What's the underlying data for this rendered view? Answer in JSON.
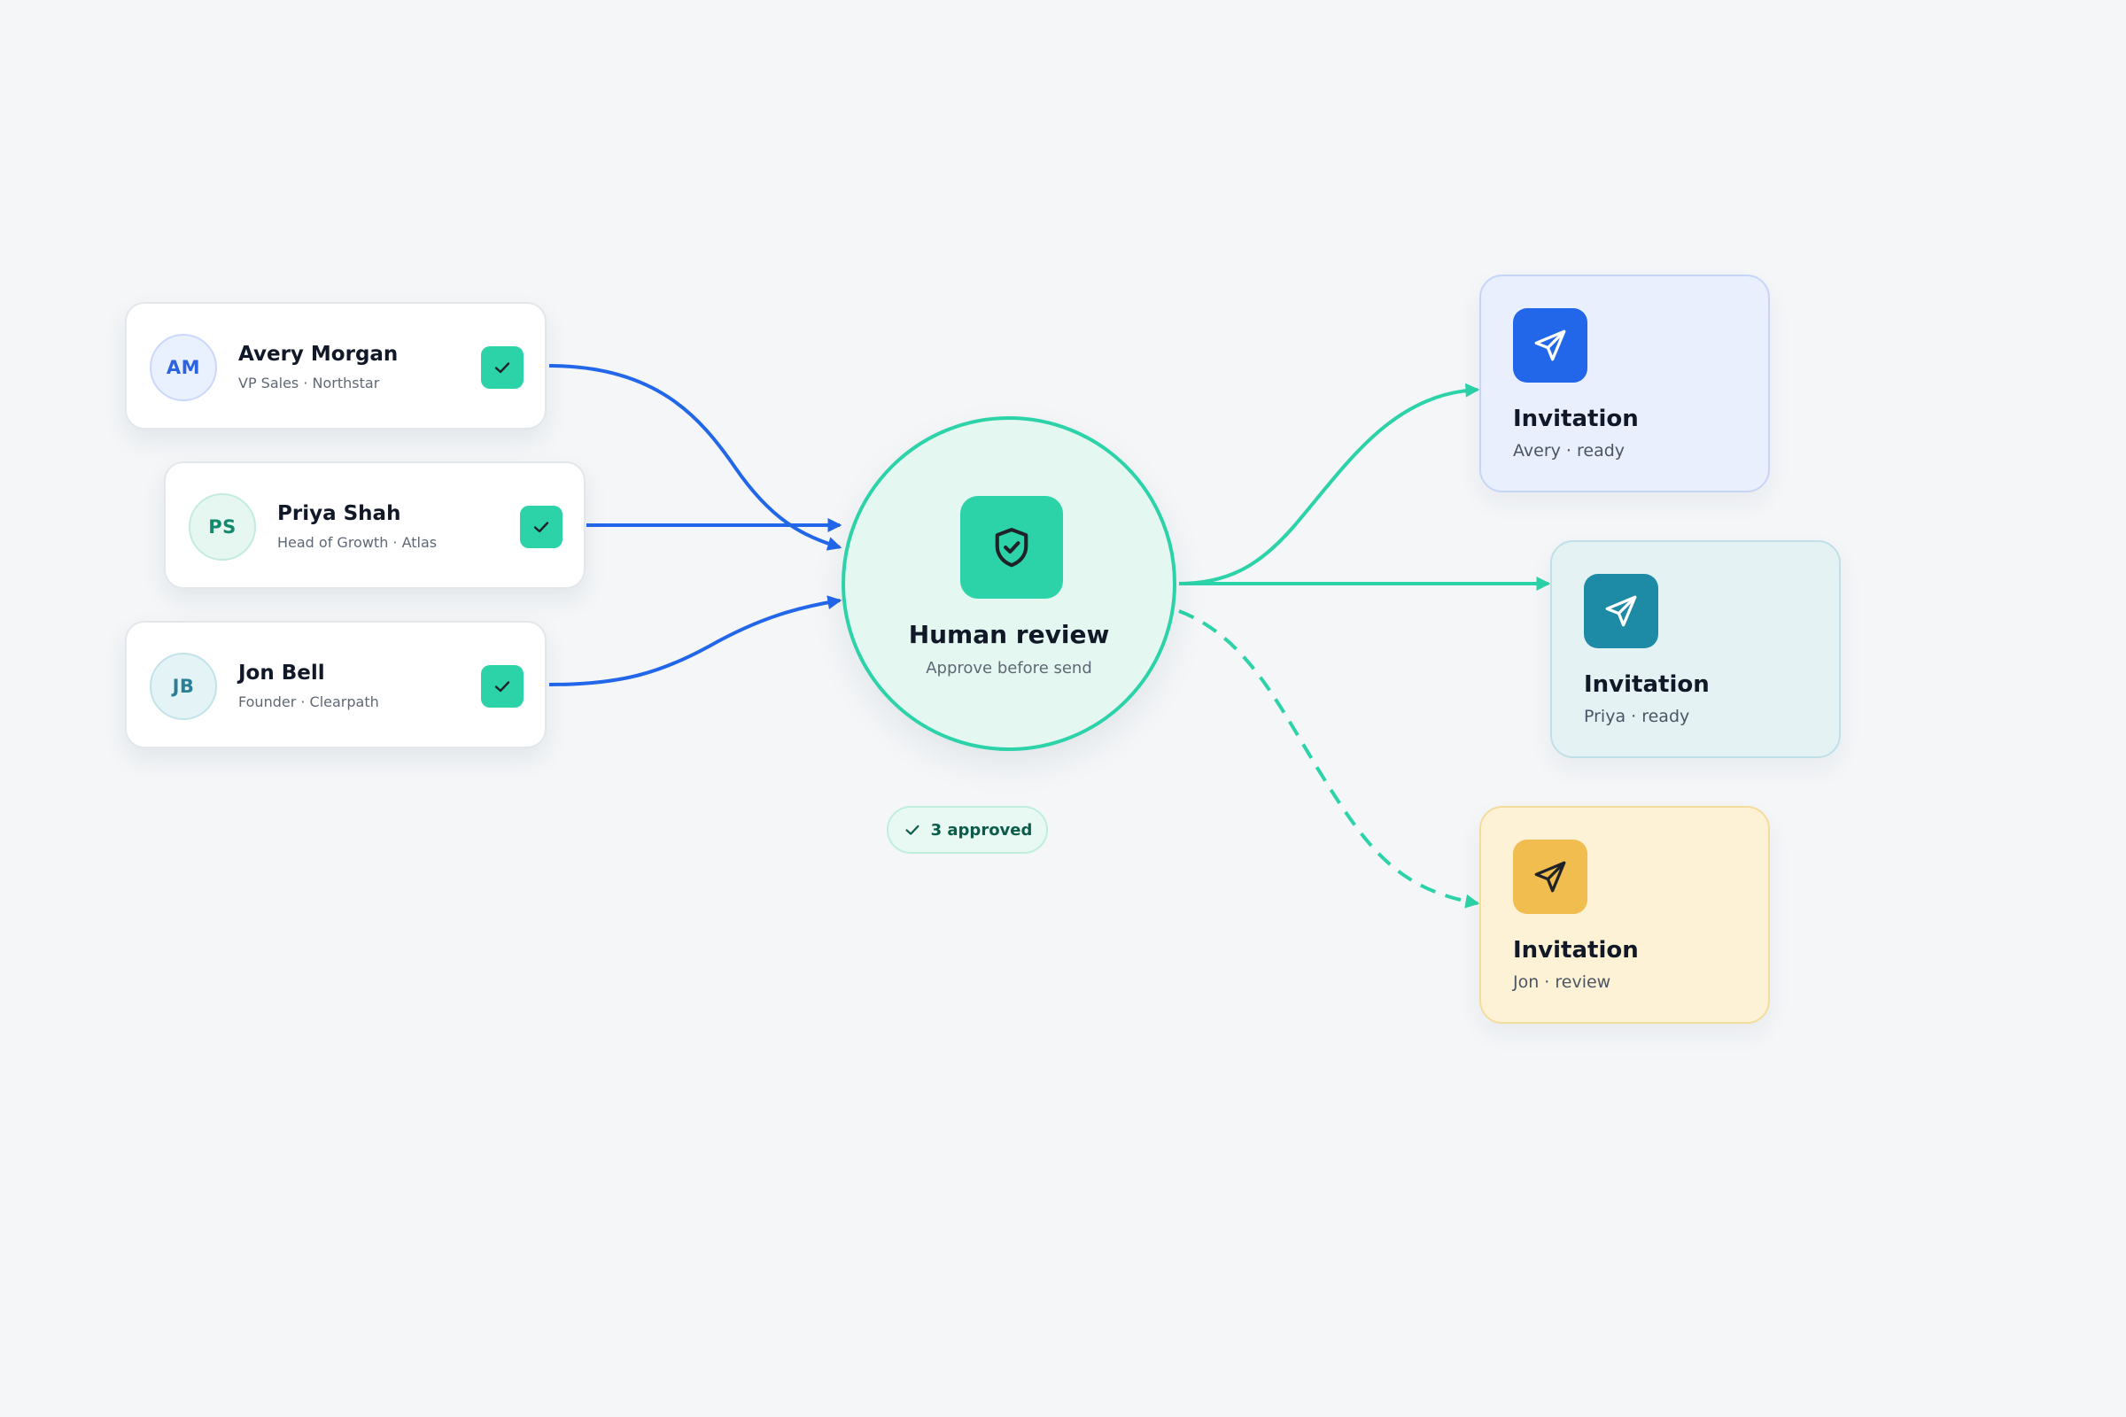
{
  "colors": {
    "background": "#f4f6f8",
    "inbound_edge": "#2266ea",
    "outbound_edge": "#2cd3a8",
    "review_fill": "#e5f7f1",
    "approve_green": "#2cd3a8"
  },
  "contacts": [
    {
      "initials": "AM",
      "name": "Avery Morgan",
      "role": "VP Sales · Northstar",
      "approved": true,
      "avatar_bg": "#e9f0fe",
      "avatar_border": "#c9d8fb",
      "avatar_text": "#2b63e0",
      "icon": "check-icon"
    },
    {
      "initials": "PS",
      "name": "Priya Shah",
      "role": "Head of Growth · Atlas",
      "approved": true,
      "avatar_bg": "#e6f7f1",
      "avatar_border": "#c2ecdc",
      "avatar_text": "#14896c",
      "icon": "check-icon"
    },
    {
      "initials": "JB",
      "name": "Jon Bell",
      "role": "Founder · Clearpath",
      "approved": true,
      "avatar_bg": "#e4f3f6",
      "avatar_border": "#c3e3ea",
      "avatar_text": "#2a7f96",
      "icon": "check-icon"
    }
  ],
  "review": {
    "title": "Human review",
    "subtitle": "Approve before send",
    "icon": "shield-check-icon"
  },
  "summary": {
    "label": "3 approved",
    "icon": "check-icon"
  },
  "invitations": [
    {
      "title": "Invitation",
      "status": "Avery · ready",
      "card_bg": "#e9effd",
      "card_border": "#c6d5f7",
      "tile_color": "#2266ea",
      "icon_color": "#ffffff",
      "icon": "send-icon",
      "link_style": "solid"
    },
    {
      "title": "Invitation",
      "status": "Priya · ready",
      "card_bg": "#e4f2f4",
      "card_border": "#bfe0e6",
      "tile_color": "#1d8aa6",
      "icon_color": "#ffffff",
      "icon": "send-icon",
      "link_style": "solid"
    },
    {
      "title": "Invitation",
      "status": "Jon · review",
      "card_bg": "#fdf2d5",
      "card_border": "#f4dc9c",
      "tile_color": "#f2bd4f",
      "icon_color": "#1f2328",
      "icon": "send-icon",
      "link_style": "dashed"
    }
  ]
}
